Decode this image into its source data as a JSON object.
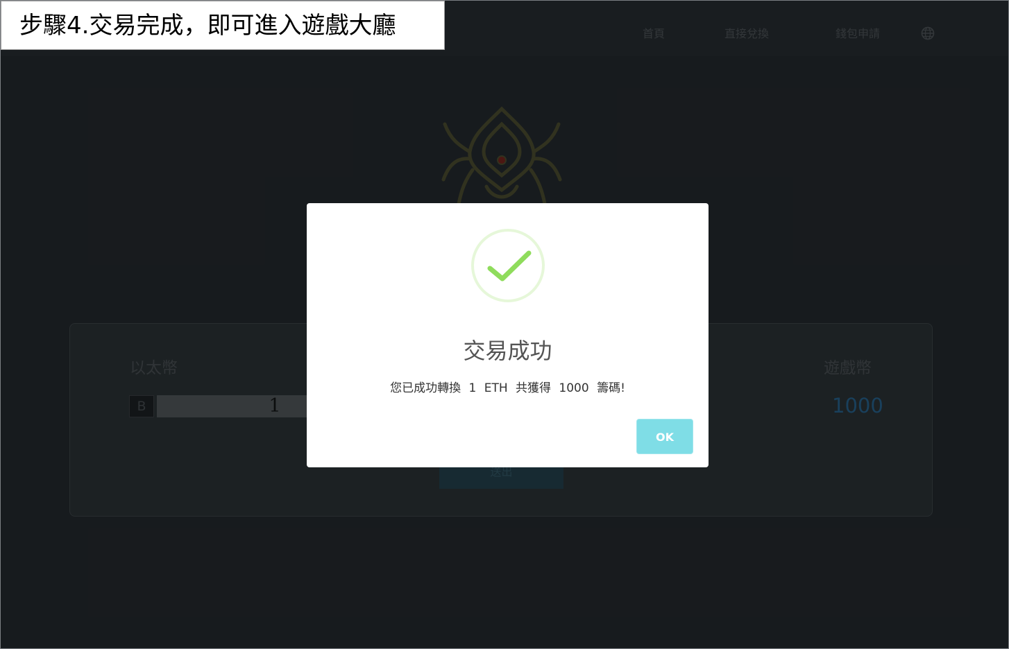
{
  "banner": {
    "text": "步驟4.交易完成，即可進入遊戲大廳"
  },
  "nav": {
    "home": "首頁",
    "exchange": "直接兌換",
    "wallet": "錢包申請",
    "language_icon": "globe-icon"
  },
  "exchange": {
    "from_label": "以太幣",
    "to_label": "遊戲幣",
    "currency_symbol": "B",
    "from_amount": "1",
    "to_amount": "1000",
    "submit_label": "送出"
  },
  "modal": {
    "icon": "checkmark-icon",
    "title": "交易成功",
    "message": "您已成功轉換 1 ETH 共獲得 1000 籌碼!",
    "ok_label": "OK"
  },
  "colors": {
    "ok_button": "#7fdde6",
    "checkmark": "#8fdc5c",
    "game_amount": "#2e75a8"
  }
}
